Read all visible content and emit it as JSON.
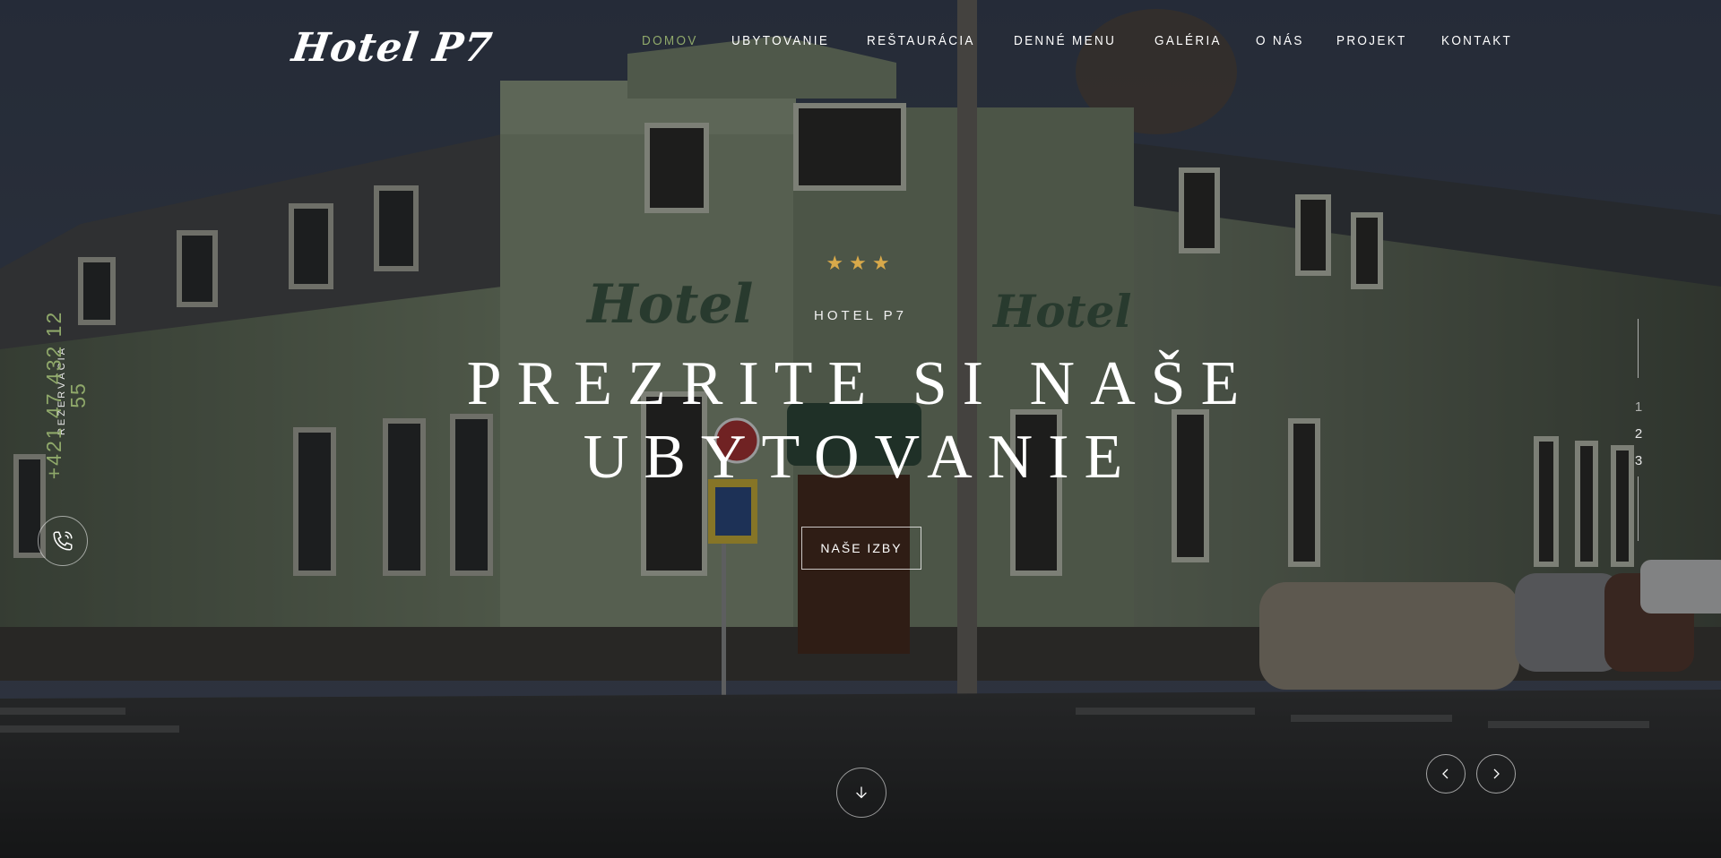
{
  "brand": {
    "logo_text": "Hotel P7"
  },
  "nav": {
    "items": [
      {
        "label": "DOMOV",
        "active": true
      },
      {
        "label": "UBYTOVANIE",
        "active": false
      },
      {
        "label": "REŠTAURÁCIA",
        "active": false
      },
      {
        "label": "DENNÉ MENU",
        "active": false
      },
      {
        "label": "GALÉRIA",
        "active": false
      },
      {
        "label": "O NÁS",
        "active": false
      },
      {
        "label": "PROJEKT",
        "active": false
      },
      {
        "label": "KONTAKT",
        "active": false
      }
    ],
    "active_color": "#8fa86a"
  },
  "reservation": {
    "label": "REZERVÁCIA",
    "phone": "+421 47 432 12 55",
    "icon": "phone-icon"
  },
  "hero": {
    "stars": "★★★",
    "kicker": "HOTEL P7",
    "title_line1": "PREZRITE SI NAŠE",
    "title_line2": "UBYTOVANIE",
    "button_label": "NAŠE IZBY",
    "star_color": "#d8a94a"
  },
  "slider": {
    "pages": [
      "1",
      "2",
      "3"
    ],
    "current": "1",
    "prev_icon": "chevron-left-icon",
    "next_icon": "chevron-right-icon",
    "scroll_icon": "arrow-down-icon"
  }
}
